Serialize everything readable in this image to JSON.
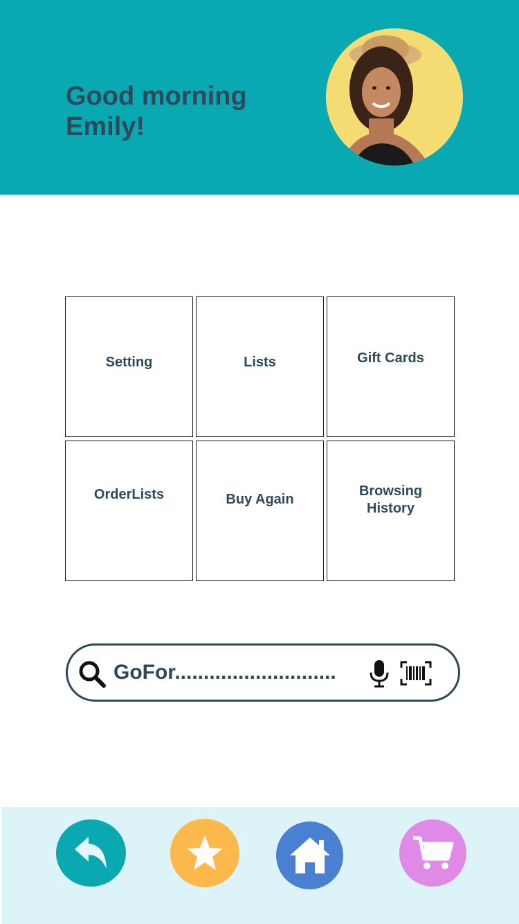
{
  "header": {
    "greeting_line1": "Good morning",
    "greeting_line2": "Emily!",
    "avatar_icon": "user-avatar-photo"
  },
  "menu": {
    "tiles": [
      {
        "label": "Setting"
      },
      {
        "label": "Lists"
      },
      {
        "label": "Gift Cards"
      },
      {
        "label": "OrderLists"
      },
      {
        "label": "Buy Again"
      },
      {
        "label": "Browsing History"
      }
    ]
  },
  "search": {
    "placeholder": "GoFor............................",
    "icons": [
      "search-icon",
      "microphone-icon",
      "barcode-scan-icon"
    ]
  },
  "bottom_nav": {
    "items": [
      {
        "icon": "back-arrow-icon",
        "color": "#0aa9b2"
      },
      {
        "icon": "star-icon",
        "color": "#fdb84c"
      },
      {
        "icon": "home-icon",
        "color": "#4a80d2"
      },
      {
        "icon": "cart-icon",
        "color": "#e08ae8"
      }
    ]
  },
  "colors": {
    "header_bg": "#08a9b3",
    "text_dark": "#2e4a5a",
    "bottom_bar_bg": "#dcf3f7"
  }
}
